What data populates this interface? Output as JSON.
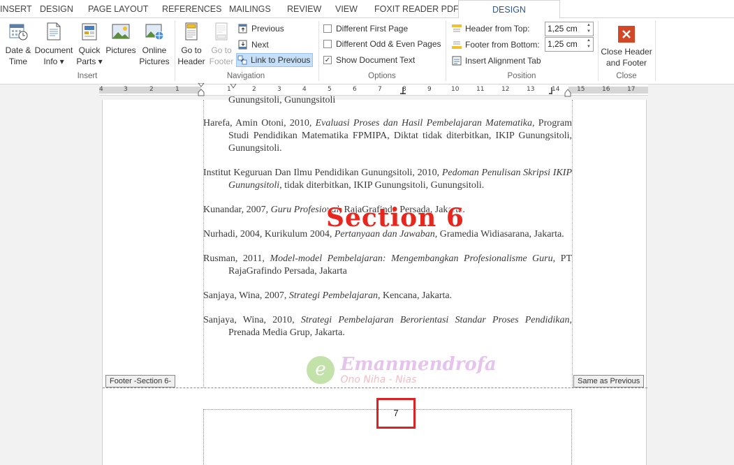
{
  "tabs": [
    "INSERT",
    "DESIGN",
    "PAGE LAYOUT",
    "REFERENCES",
    "MAILINGS",
    "REVIEW",
    "VIEW",
    "FOXIT READER PDF"
  ],
  "active_tab": "DESIGN",
  "insert_group": {
    "label": "Insert",
    "buttons": [
      {
        "line1": "Date &",
        "line2": "Time"
      },
      {
        "line1": "Document",
        "line2": "Info ▾"
      },
      {
        "line1": "Quick",
        "line2": "Parts ▾"
      },
      {
        "line1": "Pictures",
        "line2": ""
      },
      {
        "line1": "Online",
        "line2": "Pictures"
      }
    ]
  },
  "navigation_group": {
    "label": "Navigation",
    "go_to_header": {
      "line1": "Go to",
      "line2": "Header"
    },
    "go_to_footer": {
      "line1": "Go to",
      "line2": "Footer"
    },
    "previous": "Previous",
    "next": "Next",
    "link_to_previous": "Link to Previous"
  },
  "options_group": {
    "label": "Options",
    "items": [
      {
        "label": "Different First Page",
        "checked": false
      },
      {
        "label": "Different Odd & Even Pages",
        "checked": false
      },
      {
        "label": "Show Document Text",
        "checked": true
      }
    ]
  },
  "position_group": {
    "label": "Position",
    "header_from_top_label": "Header from Top:",
    "header_from_top_value": "1,25 cm",
    "footer_from_bottom_label": "Footer from Bottom:",
    "footer_from_bottom_value": "1,25 cm",
    "insert_alignment_tab": "Insert Alignment Tab"
  },
  "close_group": {
    "label": "Close",
    "close_line1": "Close Header",
    "close_line2": "and Footer"
  },
  "ruler_numbers": [
    "4",
    "3",
    "2",
    "1",
    "1",
    "2",
    "3",
    "4",
    "5",
    "6",
    "7",
    "8",
    "9",
    "10",
    "11",
    "12",
    "13",
    "14",
    "15",
    "16",
    "17"
  ],
  "document": {
    "partial_line": "Gunungsitoli, Gunungsitoli",
    "references": [
      {
        "pre": "Harefa, Amin Otoni, 2010, ",
        "italic": "Evaluasi Proses dan Hasil Pembelajaran Matematika",
        "post": ", Program Studi Pendidikan Matematika FPMIPA, Diktat tidak diterbitkan, IKIP Gunungsitoli, Gunungsitoli."
      },
      {
        "pre": "Institut Keguruan Dan Ilmu Pendidikan Gunungsitoli, 2010, ",
        "italic": "Pedoman Penulisan Skripsi IKIP Gunungsitoli",
        "post": ", tidak diterbitkan, IKIP Gunungsitoli, Gunungsitoli."
      },
      {
        "pre": "Kunandar, 2007, ",
        "italic": "Guru Profesional",
        "post": ", RajaGrafindo Persada, Jakarta."
      },
      {
        "pre": "Nurhadi, 2004, Kurikulum 2004, ",
        "italic": "Pertanyaan dan Jawaban,",
        "post": " Gramedia Widiasarana, Jakarta."
      },
      {
        "pre": "Rusman, 2011, ",
        "italic": "Model-model Pembelajaran: Mengembangkan Profesionalisme Guru",
        "post": ", PT RajaGrafindo Persada, Jakarta"
      },
      {
        "pre": "Sanjaya, Wina, 2007, ",
        "italic": "Strategi Pembelajaran",
        "post": ", Kencana, Jakarta."
      },
      {
        "pre": "Sanjaya, Wina, 2010, ",
        "italic": "Strategi Pembelajaran Berorientasi Standar Proses Pendidikan",
        "post": ", Prenada Media Grup, Jakarta."
      }
    ],
    "section_overlay": "Section 6",
    "footer_tag": "Footer -Section 6-",
    "same_as_previous": "Same as Previous",
    "page_number": "7",
    "watermark_line1": "Emanmendrofa",
    "watermark_line2": "Ono Niha - Nias",
    "watermark_logo": "e"
  },
  "colors": {
    "accent": "#2b579a",
    "highlight": "#c5dff8",
    "overlay_red": "#e8261d",
    "page_number_box": "#e02020"
  }
}
